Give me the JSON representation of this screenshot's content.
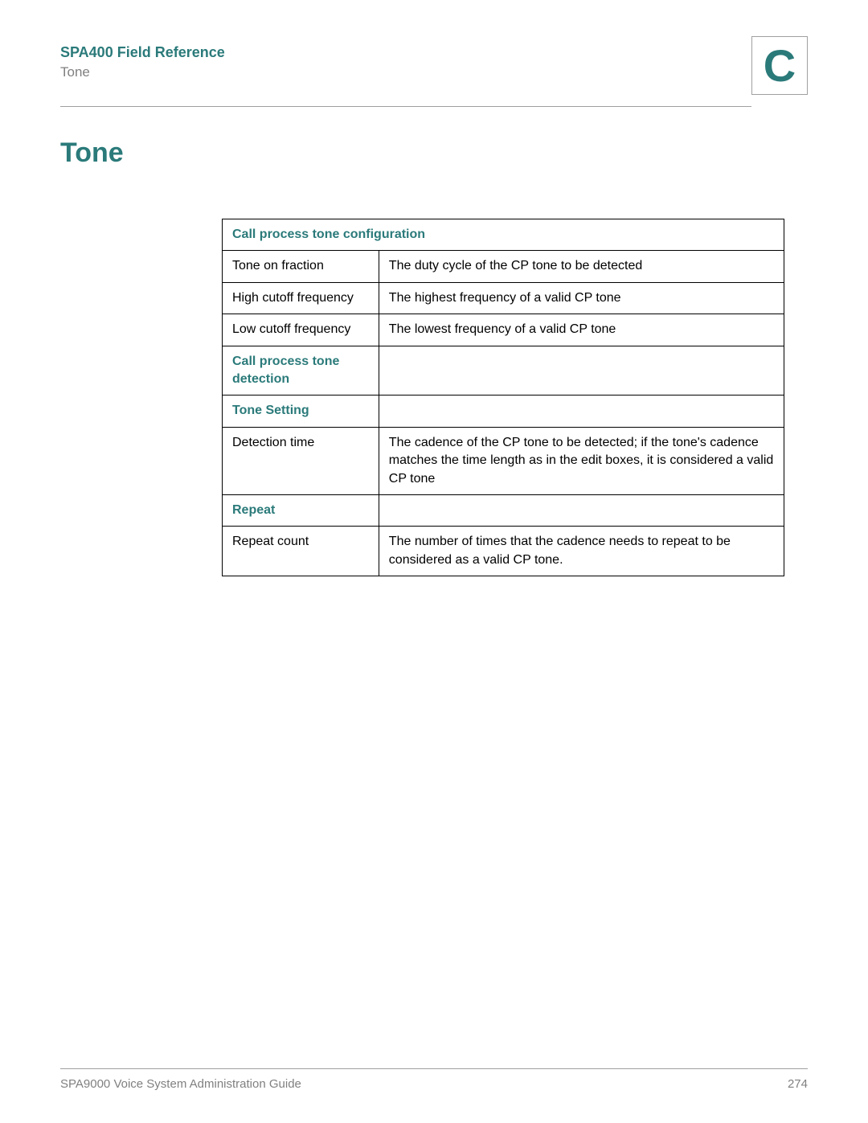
{
  "header": {
    "chapter_title": "SPA400 Field Reference",
    "section_name": "Tone",
    "appendix_letter": "C"
  },
  "section": {
    "heading": "Tone"
  },
  "table": {
    "rows": [
      {
        "type": "header-span",
        "left": "Call process tone configuration",
        "right": null
      },
      {
        "type": "data",
        "left": "Tone on fraction",
        "right": "The duty cycle of the CP tone to be detected"
      },
      {
        "type": "data",
        "left": "High cutoff frequency",
        "right": "The highest frequency of a valid CP tone"
      },
      {
        "type": "data",
        "left": "Low cutoff frequency",
        "right": "The lowest frequency of a valid CP tone"
      },
      {
        "type": "header",
        "left": "Call process tone detection",
        "right": ""
      },
      {
        "type": "header",
        "left": "Tone Setting",
        "right": ""
      },
      {
        "type": "data",
        "left": "Detection time",
        "right": "The cadence of the CP tone to be detected; if the tone's cadence matches the time length as in the edit boxes, it is considered a valid CP tone"
      },
      {
        "type": "header",
        "left": "Repeat",
        "right": ""
      },
      {
        "type": "data",
        "left": "Repeat count",
        "right": "The number of times that the cadence needs to repeat to be considered as a valid CP tone."
      }
    ]
  },
  "footer": {
    "guide_title": "SPA9000 Voice System Administration Guide",
    "page_number": "274"
  }
}
